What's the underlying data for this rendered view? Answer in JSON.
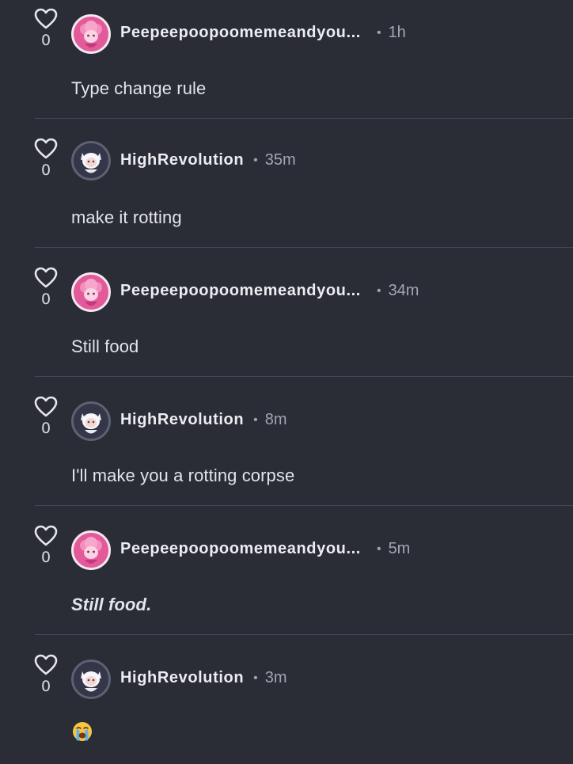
{
  "comments": [
    {
      "username": "Peepeepoopoomemeandyou...",
      "separator": "•",
      "time": "1h",
      "likes": "0",
      "body": "Type change rule"
    },
    {
      "username": "HighRevolution",
      "separator": "•",
      "time": "35m",
      "likes": "0",
      "body": "make it rotting"
    },
    {
      "username": "Peepeepoopoomemeandyou...",
      "separator": "•",
      "time": "34m",
      "likes": "0",
      "body": "Still food"
    },
    {
      "username": "HighRevolution",
      "separator": "•",
      "time": "8m",
      "likes": "0",
      "body": "I'll make you a rotting corpse"
    },
    {
      "username": "Peepeepoopoomemeandyou...",
      "separator": "•",
      "time": "5m",
      "likes": "0",
      "body": "Still food."
    },
    {
      "username": "HighRevolution",
      "separator": "•",
      "time": "3m",
      "likes": "0",
      "body_emoji": "loudly-crying-face-emoji"
    }
  ],
  "icons": {
    "like": "heart-outline-icon",
    "avatar_pink": "pink-character-avatar",
    "avatar_white": "white-cat-character-avatar"
  },
  "colors": {
    "background": "#2a2c36",
    "divider": "#444754",
    "text": "#e4e5ea",
    "muted": "#a3a6b2",
    "avatar_pink": "#e35a9b"
  }
}
